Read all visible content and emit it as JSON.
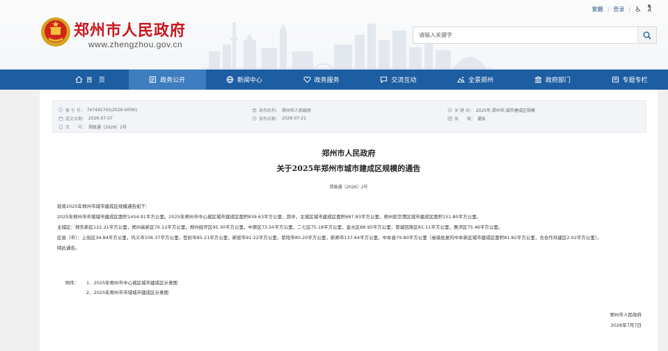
{
  "top_links": {
    "lang": "繁體",
    "login": "登录",
    "accessibility_icon": "accessibility-icon",
    "elder_icon": "elder-mode-icon"
  },
  "site": {
    "name": "郑州市人民政府",
    "url": "www.zhengzhou.gov.cn"
  },
  "search": {
    "placeholder": "请输入关键字"
  },
  "nav": [
    {
      "label": "首　页",
      "icon": "home-icon"
    },
    {
      "label": "政务公开",
      "icon": "document-icon",
      "active": true
    },
    {
      "label": "新闻中心",
      "icon": "globe-icon"
    },
    {
      "label": "政务服务",
      "icon": "heart-icon"
    },
    {
      "label": "交流互动",
      "icon": "chat-icon"
    },
    {
      "label": "全景郑州",
      "icon": "panorama-icon"
    },
    {
      "label": "政府部门",
      "icon": "building-icon"
    },
    {
      "label": "专题专栏",
      "icon": "column-icon"
    }
  ],
  "meta": {
    "index_label": "索 引 号：",
    "index_value": "747445745/2026-00061",
    "publisher_label": "发布机构：",
    "publisher_value": "郑州市人民政府",
    "keywords_label": "关 键 词：",
    "keywords_value": "2025年,郑州市,城市建成区规模",
    "created_label": "成文日期：",
    "created_value": "2026-07-07",
    "published_label": "发布日期：",
    "published_value": "2026-07-21",
    "genre_label": "体　　裁：",
    "genre_value": "通告",
    "docno_label": "文　　号：",
    "docno_value": "郑政通〔2026〕2号"
  },
  "document": {
    "org": "郑州市人民政府",
    "title": "关于2025年郑州市城市建成区规模的通告",
    "number": "郑政通〔2026〕2号",
    "paragraphs": [
      "现将2025年郑州市城市建成区规模通告如下：",
      "2025年郑州市市域城市建成区面积1454.91平方公里。2025年郑州市中心城区城市建成区面积839.63平方公里，其中，主城区城市建成区面积687.83平方公里，郑州航空港区城市建成区面积151.80平方公里。",
      "主城区：郑东新区122.21平方公里，郑州高新区76.12平方公里，郑州经开区95.30平方公里，中原区73.50平方公里，二七区75.18平方公里，金水区88.95平方公里，管城回族区81.11平方公里，惠济区75.46平方公里。",
      "区县（市）：上街区34.84平方公里，巩义市106.37平方公里，登封市85.21平方公里，新密市91.22平方公里，荥阳市80.20平方公里，新郑市137.64平方公里，中牟县79.80平方公里（省级批复的中牟新区城市建成区面积81.82平方公里，含合作共建区2.02平方公里）。",
      "特此通告。"
    ],
    "attach_label": "附件：",
    "attachments": [
      "1．2025年郑州市中心城区城市建成区示意图",
      "2．2025年郑州市市域城市建成区示意图"
    ],
    "signer": "郑州市人民政府",
    "date": "2026年7月7日"
  },
  "colors": {
    "nav_bg": "#1d5da1",
    "nav_active": "#3d7dc0",
    "brand_red": "#c7161d"
  }
}
